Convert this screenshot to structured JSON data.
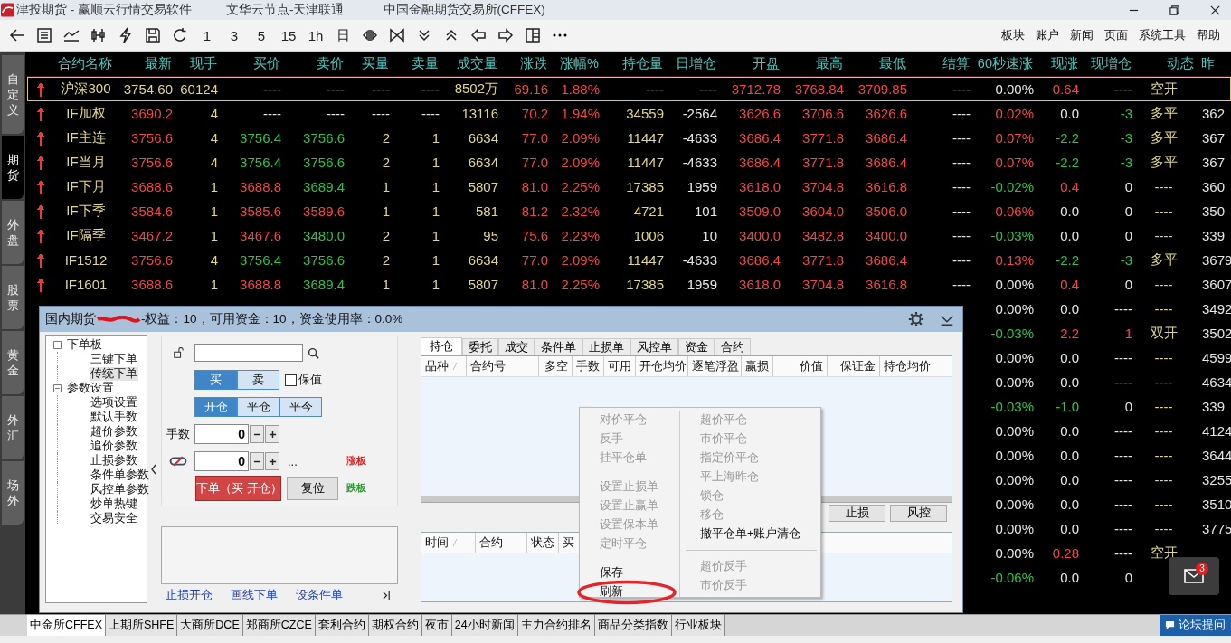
{
  "title_bar": {
    "title": "津投期货 - 赢顺云行情交易软件",
    "server": "文华云节点-天津联通",
    "exchange": "中国金融期货交易所(CFFEX)"
  },
  "toolbar": {
    "periods": [
      "1",
      "3",
      "5",
      "15",
      "1h",
      "日"
    ],
    "menu": [
      "板块",
      "账户",
      "新闻",
      "页面",
      "系统工具",
      "帮助"
    ]
  },
  "side_tabs": [
    {
      "label": "自定义",
      "selected": false
    },
    {
      "label": "期货",
      "selected": true
    },
    {
      "label": "外盘",
      "selected": false
    },
    {
      "label": "股票",
      "selected": false
    },
    {
      "label": "黄金",
      "selected": false
    },
    {
      "label": "外汇",
      "selected": false
    },
    {
      "label": "场外",
      "selected": false
    }
  ],
  "quotes": {
    "name_column": "合约名称",
    "columns": [
      "最新",
      "现手",
      "买价",
      "卖价",
      "买量",
      "卖量",
      "成交量",
      "涨跌",
      "涨幅%",
      "持仓量",
      "日增仓",
      "开盘",
      "最高",
      "最低",
      "结算",
      "60秒速涨",
      "现涨",
      "现增仓",
      "动态",
      "昨"
    ],
    "rows": [
      {
        "selected": true,
        "arrow": {
          "color": "#e83c3c"
        },
        "name": "沪深300",
        "cells": [
          {
            "text": "3754.60",
            "color": "#e2d68c"
          },
          {
            "text": "60124",
            "color": "#e2d68c"
          },
          {
            "text": "----",
            "color": "#e6e6e6"
          },
          {
            "text": "----",
            "color": "#e6e6e6"
          },
          {
            "text": "----",
            "color": "#e6e6e6"
          },
          {
            "text": "----",
            "color": "#e6e6e6"
          },
          {
            "text": "8502万",
            "color": "#e2d68c"
          },
          {
            "text": "69.16",
            "color": "#f04848"
          },
          {
            "text": "1.88%",
            "color": "#f04848"
          },
          {
            "text": "----",
            "color": "#e6e6e6"
          },
          {
            "text": "----",
            "color": "#e6e6e6"
          },
          {
            "text": "3712.78",
            "color": "#f04848"
          },
          {
            "text": "3768.84",
            "color": "#f04848"
          },
          {
            "text": "3709.85",
            "color": "#f04848"
          },
          {
            "text": "----",
            "color": "#e6e6e6"
          },
          {
            "text": "0.00%",
            "color": "#e6e6e6"
          },
          {
            "text": "0.64",
            "color": "#f04848"
          },
          {
            "text": "----",
            "color": "#e6e6e6"
          },
          {
            "text": "空开",
            "color": "#e2d68c"
          },
          {
            "text": ""
          }
        ]
      },
      {
        "selected": false,
        "arrow": {
          "color": "#e83c3c"
        },
        "name": "IF加权",
        "cells": [
          {
            "text": "3690.2",
            "color": "#f04848"
          },
          {
            "text": "4",
            "color": "#e2d68c"
          },
          {
            "text": "----",
            "color": "#e6e6e6"
          },
          {
            "text": "----",
            "color": "#e6e6e6"
          },
          {
            "text": "----",
            "color": "#e6e6e6"
          },
          {
            "text": "----",
            "color": "#e6e6e6"
          },
          {
            "text": "13116",
            "color": "#e2d68c"
          },
          {
            "text": "70.2",
            "color": "#f04848"
          },
          {
            "text": "1.94%",
            "color": "#f04848"
          },
          {
            "text": "34559",
            "color": "#e2d68c"
          },
          {
            "text": "-2564",
            "color": "#e6e6e6"
          },
          {
            "text": "3626.6",
            "color": "#f04848"
          },
          {
            "text": "3706.6",
            "color": "#f04848"
          },
          {
            "text": "3626.6",
            "color": "#f04848"
          },
          {
            "text": "----",
            "color": "#e6e6e6"
          },
          {
            "text": "0.02%",
            "color": "#f04848"
          },
          {
            "text": "0.0",
            "color": "#e6e6e6"
          },
          {
            "text": "-3",
            "color": "#2fc24a"
          },
          {
            "text": "多平",
            "color": "#e2d68c"
          },
          {
            "text": "362",
            "color": "#e6e6e6"
          }
        ]
      },
      {
        "selected": false,
        "arrow": {
          "color": "#e83c3c"
        },
        "name": "IF主连",
        "cells": [
          {
            "text": "3756.6",
            "color": "#f04848"
          },
          {
            "text": "4",
            "color": "#e2d68c"
          },
          {
            "text": "3756.4",
            "color": "#2fc24a"
          },
          {
            "text": "3756.6",
            "color": "#2fc24a"
          },
          {
            "text": "2",
            "color": "#e2d68c"
          },
          {
            "text": "1",
            "color": "#e2d68c"
          },
          {
            "text": "6634",
            "color": "#e2d68c"
          },
          {
            "text": "77.0",
            "color": "#f04848"
          },
          {
            "text": "2.09%",
            "color": "#f04848"
          },
          {
            "text": "11447",
            "color": "#e2d68c"
          },
          {
            "text": "-4633",
            "color": "#e6e6e6"
          },
          {
            "text": "3686.4",
            "color": "#f04848"
          },
          {
            "text": "3771.8",
            "color": "#f04848"
          },
          {
            "text": "3686.4",
            "color": "#f04848"
          },
          {
            "text": "----",
            "color": "#e6e6e6"
          },
          {
            "text": "0.07%",
            "color": "#f04848"
          },
          {
            "text": "-2.2",
            "color": "#2fc24a"
          },
          {
            "text": "-3",
            "color": "#2fc24a"
          },
          {
            "text": "多平",
            "color": "#e2d68c"
          },
          {
            "text": "367",
            "color": "#e6e6e6"
          }
        ]
      },
      {
        "selected": false,
        "arrow": {
          "color": "#e83c3c"
        },
        "name": "IF当月",
        "cells": [
          {
            "text": "3756.6",
            "color": "#f04848"
          },
          {
            "text": "4",
            "color": "#e2d68c"
          },
          {
            "text": "3756.4",
            "color": "#2fc24a"
          },
          {
            "text": "3756.6",
            "color": "#2fc24a"
          },
          {
            "text": "2",
            "color": "#e2d68c"
          },
          {
            "text": "1",
            "color": "#e2d68c"
          },
          {
            "text": "6634",
            "color": "#e2d68c"
          },
          {
            "text": "77.0",
            "color": "#f04848"
          },
          {
            "text": "2.09%",
            "color": "#f04848"
          },
          {
            "text": "11447",
            "color": "#e2d68c"
          },
          {
            "text": "-4633",
            "color": "#e6e6e6"
          },
          {
            "text": "3686.4",
            "color": "#f04848"
          },
          {
            "text": "3771.8",
            "color": "#f04848"
          },
          {
            "text": "3686.4",
            "color": "#f04848"
          },
          {
            "text": "----",
            "color": "#e6e6e6"
          },
          {
            "text": "0.07%",
            "color": "#f04848"
          },
          {
            "text": "-2.2",
            "color": "#2fc24a"
          },
          {
            "text": "-3",
            "color": "#2fc24a"
          },
          {
            "text": "多平",
            "color": "#e2d68c"
          },
          {
            "text": "367",
            "color": "#e6e6e6"
          }
        ]
      },
      {
        "selected": false,
        "arrow": {
          "color": "#e83c3c"
        },
        "name": "IF下月",
        "cells": [
          {
            "text": "3688.6",
            "color": "#f04848"
          },
          {
            "text": "1",
            "color": "#e2d68c"
          },
          {
            "text": "3688.8",
            "color": "#f04848"
          },
          {
            "text": "3689.4",
            "color": "#2fc24a"
          },
          {
            "text": "1",
            "color": "#e2d68c"
          },
          {
            "text": "1",
            "color": "#e2d68c"
          },
          {
            "text": "5807",
            "color": "#e2d68c"
          },
          {
            "text": "81.0",
            "color": "#f04848"
          },
          {
            "text": "2.25%",
            "color": "#f04848"
          },
          {
            "text": "17385",
            "color": "#e2d68c"
          },
          {
            "text": "1959",
            "color": "#e6e6e6"
          },
          {
            "text": "3618.0",
            "color": "#f04848"
          },
          {
            "text": "3704.8",
            "color": "#f04848"
          },
          {
            "text": "3616.8",
            "color": "#f04848"
          },
          {
            "text": "----",
            "color": "#e6e6e6"
          },
          {
            "text": "-0.02%",
            "color": "#2fc24a"
          },
          {
            "text": "0.4",
            "color": "#f04848"
          },
          {
            "text": "0",
            "color": "#e6e6e6"
          },
          {
            "text": "----",
            "color": "#e2d68c"
          },
          {
            "text": "360",
            "color": "#e6e6e6"
          }
        ]
      },
      {
        "selected": false,
        "arrow": {
          "color": "#e83c3c"
        },
        "name": "IF下季",
        "cells": [
          {
            "text": "3584.6",
            "color": "#f04848"
          },
          {
            "text": "1",
            "color": "#e2d68c"
          },
          {
            "text": "3585.6",
            "color": "#f04848"
          },
          {
            "text": "3589.6",
            "color": "#f04848"
          },
          {
            "text": "1",
            "color": "#e2d68c"
          },
          {
            "text": "1",
            "color": "#e2d68c"
          },
          {
            "text": "581",
            "color": "#e2d68c"
          },
          {
            "text": "81.2",
            "color": "#f04848"
          },
          {
            "text": "2.32%",
            "color": "#f04848"
          },
          {
            "text": "4721",
            "color": "#e2d68c"
          },
          {
            "text": "101",
            "color": "#e6e6e6"
          },
          {
            "text": "3509.0",
            "color": "#f04848"
          },
          {
            "text": "3604.0",
            "color": "#f04848"
          },
          {
            "text": "3506.0",
            "color": "#f04848"
          },
          {
            "text": "----",
            "color": "#e6e6e6"
          },
          {
            "text": "0.06%",
            "color": "#f04848"
          },
          {
            "text": "0.0",
            "color": "#e6e6e6"
          },
          {
            "text": "0",
            "color": "#e6e6e6"
          },
          {
            "text": "----",
            "color": "#e2d68c"
          },
          {
            "text": "350",
            "color": "#e6e6e6"
          }
        ]
      },
      {
        "selected": false,
        "arrow": {
          "color": "#e83c3c"
        },
        "name": "IF隔季",
        "cells": [
          {
            "text": "3467.2",
            "color": "#f04848"
          },
          {
            "text": "1",
            "color": "#e2d68c"
          },
          {
            "text": "3467.6",
            "color": "#f04848"
          },
          {
            "text": "3480.0",
            "color": "#2fc24a"
          },
          {
            "text": "2",
            "color": "#e2d68c"
          },
          {
            "text": "1",
            "color": "#e2d68c"
          },
          {
            "text": "95",
            "color": "#e2d68c"
          },
          {
            "text": "75.6",
            "color": "#f04848"
          },
          {
            "text": "2.23%",
            "color": "#f04848"
          },
          {
            "text": "1006",
            "color": "#e2d68c"
          },
          {
            "text": "10",
            "color": "#e6e6e6"
          },
          {
            "text": "3400.0",
            "color": "#f04848"
          },
          {
            "text": "3482.8",
            "color": "#f04848"
          },
          {
            "text": "3400.0",
            "color": "#f04848"
          },
          {
            "text": "----",
            "color": "#e6e6e6"
          },
          {
            "text": "-0.03%",
            "color": "#2fc24a"
          },
          {
            "text": "0.0",
            "color": "#e6e6e6"
          },
          {
            "text": "0",
            "color": "#e6e6e6"
          },
          {
            "text": "----",
            "color": "#e2d68c"
          },
          {
            "text": "339",
            "color": "#e6e6e6"
          }
        ]
      },
      {
        "selected": false,
        "arrow": {
          "color": "#e83c3c"
        },
        "name": "IF1512",
        "cells": [
          {
            "text": "3756.6",
            "color": "#f04848"
          },
          {
            "text": "4",
            "color": "#e2d68c"
          },
          {
            "text": "3756.4",
            "color": "#2fc24a"
          },
          {
            "text": "3756.6",
            "color": "#2fc24a"
          },
          {
            "text": "2",
            "color": "#e2d68c"
          },
          {
            "text": "1",
            "color": "#e2d68c"
          },
          {
            "text": "6634",
            "color": "#e2d68c"
          },
          {
            "text": "77.0",
            "color": "#f04848"
          },
          {
            "text": "2.09%",
            "color": "#f04848"
          },
          {
            "text": "11447",
            "color": "#e2d68c"
          },
          {
            "text": "-4633",
            "color": "#e6e6e6"
          },
          {
            "text": "3686.4",
            "color": "#f04848"
          },
          {
            "text": "3771.8",
            "color": "#f04848"
          },
          {
            "text": "3686.4",
            "color": "#f04848"
          },
          {
            "text": "----",
            "color": "#e6e6e6"
          },
          {
            "text": "0.13%",
            "color": "#f04848"
          },
          {
            "text": "-2.2",
            "color": "#2fc24a"
          },
          {
            "text": "-3",
            "color": "#2fc24a"
          },
          {
            "text": "多平",
            "color": "#e2d68c"
          },
          {
            "text": "3679",
            "color": "#e6e6e6"
          }
        ]
      },
      {
        "selected": false,
        "arrow": {
          "color": "#e83c3c"
        },
        "name": "IF1601",
        "cells": [
          {
            "text": "3688.6",
            "color": "#f04848"
          },
          {
            "text": "1",
            "color": "#e2d68c"
          },
          {
            "text": "3688.8",
            "color": "#f04848"
          },
          {
            "text": "3689.4",
            "color": "#2fc24a"
          },
          {
            "text": "1",
            "color": "#e2d68c"
          },
          {
            "text": "1",
            "color": "#e2d68c"
          },
          {
            "text": "5807",
            "color": "#e2d68c"
          },
          {
            "text": "81.0",
            "color": "#f04848"
          },
          {
            "text": "2.25%",
            "color": "#f04848"
          },
          {
            "text": "17385",
            "color": "#e2d68c"
          },
          {
            "text": "1959",
            "color": "#e6e6e6"
          },
          {
            "text": "3618.0",
            "color": "#f04848"
          },
          {
            "text": "3704.8",
            "color": "#f04848"
          },
          {
            "text": "3616.8",
            "color": "#f04848"
          },
          {
            "text": "----",
            "color": "#e6e6e6"
          },
          {
            "text": "0.00%",
            "color": "#e6e6e6"
          },
          {
            "text": "0.4",
            "color": "#f04848"
          },
          {
            "text": "0",
            "color": "#e6e6e6"
          },
          {
            "text": "----",
            "color": "#e2d68c"
          },
          {
            "text": "3607",
            "color": "#e6e6e6"
          }
        ]
      },
      {
        "selected": false,
        "cells": [
          {
            "text": ""
          },
          {
            "text": ""
          },
          {
            "text": ""
          },
          {
            "text": ""
          },
          {
            "text": ""
          },
          {
            "text": ""
          },
          {
            "text": ""
          },
          {
            "text": ""
          },
          {
            "text": ""
          },
          {
            "text": ""
          },
          {
            "text": ""
          },
          {
            "text": ""
          },
          {
            "text": ""
          },
          {
            "text": ""
          },
          {
            "text": ""
          },
          {
            "text": "0.00%",
            "color": "#e6e6e6"
          },
          {
            "text": "0.0",
            "color": "#e6e6e6"
          },
          {
            "text": "----",
            "color": "#e6e6e6"
          },
          {
            "text": "----",
            "color": "#e2d68c"
          },
          {
            "text": "3492",
            "color": "#e6e6e6"
          }
        ]
      },
      {
        "selected": false,
        "cells": [
          {
            "text": ""
          },
          {
            "text": ""
          },
          {
            "text": ""
          },
          {
            "text": ""
          },
          {
            "text": ""
          },
          {
            "text": ""
          },
          {
            "text": ""
          },
          {
            "text": ""
          },
          {
            "text": ""
          },
          {
            "text": ""
          },
          {
            "text": ""
          },
          {
            "text": ""
          },
          {
            "text": ""
          },
          {
            "text": ""
          },
          {
            "text": ""
          },
          {
            "text": "-0.03%",
            "color": "#2fc24a"
          },
          {
            "text": "2.2",
            "color": "#f04848"
          },
          {
            "text": "1",
            "color": "#f04848"
          },
          {
            "text": "双开",
            "color": "#e2d68c"
          },
          {
            "text": "3502",
            "color": "#e6e6e6"
          }
        ]
      },
      {
        "selected": false,
        "cells": [
          {
            "text": ""
          },
          {
            "text": ""
          },
          {
            "text": ""
          },
          {
            "text": ""
          },
          {
            "text": ""
          },
          {
            "text": ""
          },
          {
            "text": ""
          },
          {
            "text": ""
          },
          {
            "text": ""
          },
          {
            "text": ""
          },
          {
            "text": ""
          },
          {
            "text": ""
          },
          {
            "text": ""
          },
          {
            "text": ""
          },
          {
            "text": ""
          },
          {
            "text": "0.00%",
            "color": "#e6e6e6"
          },
          {
            "text": "0.0",
            "color": "#e6e6e6"
          },
          {
            "text": "----",
            "color": "#e6e6e6"
          },
          {
            "text": "----",
            "color": "#e2d68c"
          },
          {
            "text": "4599",
            "color": "#e6e6e6"
          }
        ]
      },
      {
        "selected": false,
        "cells": [
          {
            "text": ""
          },
          {
            "text": ""
          },
          {
            "text": ""
          },
          {
            "text": ""
          },
          {
            "text": ""
          },
          {
            "text": ""
          },
          {
            "text": ""
          },
          {
            "text": ""
          },
          {
            "text": ""
          },
          {
            "text": ""
          },
          {
            "text": ""
          },
          {
            "text": ""
          },
          {
            "text": ""
          },
          {
            "text": ""
          },
          {
            "text": ""
          },
          {
            "text": "0.00%",
            "color": "#e6e6e6"
          },
          {
            "text": "0.0",
            "color": "#e6e6e6"
          },
          {
            "text": "----",
            "color": "#e6e6e6"
          },
          {
            "text": "----",
            "color": "#e2d68c"
          },
          {
            "text": "4634",
            "color": "#e6e6e6"
          }
        ]
      },
      {
        "selected": false,
        "cells": [
          {
            "text": ""
          },
          {
            "text": ""
          },
          {
            "text": ""
          },
          {
            "text": ""
          },
          {
            "text": ""
          },
          {
            "text": ""
          },
          {
            "text": ""
          },
          {
            "text": ""
          },
          {
            "text": ""
          },
          {
            "text": ""
          },
          {
            "text": ""
          },
          {
            "text": ""
          },
          {
            "text": ""
          },
          {
            "text": ""
          },
          {
            "text": ""
          },
          {
            "text": "-0.03%",
            "color": "#2fc24a"
          },
          {
            "text": "-1.0",
            "color": "#2fc24a"
          },
          {
            "text": "0",
            "color": "#e6e6e6"
          },
          {
            "text": "----",
            "color": "#e2d68c"
          },
          {
            "text": "339",
            "color": "#e6e6e6"
          }
        ]
      },
      {
        "selected": false,
        "cells": [
          {
            "text": ""
          },
          {
            "text": ""
          },
          {
            "text": ""
          },
          {
            "text": ""
          },
          {
            "text": ""
          },
          {
            "text": ""
          },
          {
            "text": ""
          },
          {
            "text": ""
          },
          {
            "text": ""
          },
          {
            "text": ""
          },
          {
            "text": ""
          },
          {
            "text": ""
          },
          {
            "text": ""
          },
          {
            "text": ""
          },
          {
            "text": ""
          },
          {
            "text": "0.00%",
            "color": "#e6e6e6"
          },
          {
            "text": "0.0",
            "color": "#e6e6e6"
          },
          {
            "text": "----",
            "color": "#e6e6e6"
          },
          {
            "text": "----",
            "color": "#e2d68c"
          },
          {
            "text": "4124",
            "color": "#e6e6e6"
          }
        ]
      },
      {
        "selected": false,
        "cells": [
          {
            "text": ""
          },
          {
            "text": ""
          },
          {
            "text": ""
          },
          {
            "text": ""
          },
          {
            "text": ""
          },
          {
            "text": ""
          },
          {
            "text": ""
          },
          {
            "text": ""
          },
          {
            "text": ""
          },
          {
            "text": ""
          },
          {
            "text": ""
          },
          {
            "text": ""
          },
          {
            "text": ""
          },
          {
            "text": ""
          },
          {
            "text": ""
          },
          {
            "text": "0.00%",
            "color": "#e6e6e6"
          },
          {
            "text": "0.0",
            "color": "#e6e6e6"
          },
          {
            "text": "----",
            "color": "#e6e6e6"
          },
          {
            "text": "----",
            "color": "#e2d68c"
          },
          {
            "text": "3644",
            "color": "#e6e6e6"
          }
        ]
      },
      {
        "selected": false,
        "cells": [
          {
            "text": ""
          },
          {
            "text": ""
          },
          {
            "text": ""
          },
          {
            "text": ""
          },
          {
            "text": ""
          },
          {
            "text": ""
          },
          {
            "text": ""
          },
          {
            "text": ""
          },
          {
            "text": ""
          },
          {
            "text": ""
          },
          {
            "text": ""
          },
          {
            "text": ""
          },
          {
            "text": ""
          },
          {
            "text": ""
          },
          {
            "text": ""
          },
          {
            "text": "0.00%",
            "color": "#e6e6e6"
          },
          {
            "text": "0.0",
            "color": "#e6e6e6"
          },
          {
            "text": "----",
            "color": "#e6e6e6"
          },
          {
            "text": "----",
            "color": "#e2d68c"
          },
          {
            "text": "3255",
            "color": "#e6e6e6"
          }
        ]
      },
      {
        "selected": false,
        "cells": [
          {
            "text": ""
          },
          {
            "text": ""
          },
          {
            "text": ""
          },
          {
            "text": ""
          },
          {
            "text": ""
          },
          {
            "text": ""
          },
          {
            "text": ""
          },
          {
            "text": ""
          },
          {
            "text": ""
          },
          {
            "text": ""
          },
          {
            "text": ""
          },
          {
            "text": ""
          },
          {
            "text": ""
          },
          {
            "text": ""
          },
          {
            "text": ""
          },
          {
            "text": "0.00%",
            "color": "#e6e6e6"
          },
          {
            "text": "0.0",
            "color": "#e6e6e6"
          },
          {
            "text": "----",
            "color": "#e6e6e6"
          },
          {
            "text": "----",
            "color": "#e2d68c"
          },
          {
            "text": "3510",
            "color": "#e6e6e6"
          }
        ]
      },
      {
        "selected": false,
        "cells": [
          {
            "text": ""
          },
          {
            "text": ""
          },
          {
            "text": ""
          },
          {
            "text": ""
          },
          {
            "text": ""
          },
          {
            "text": ""
          },
          {
            "text": ""
          },
          {
            "text": ""
          },
          {
            "text": ""
          },
          {
            "text": ""
          },
          {
            "text": ""
          },
          {
            "text": ""
          },
          {
            "text": ""
          },
          {
            "text": ""
          },
          {
            "text": ""
          },
          {
            "text": "0.00%",
            "color": "#e6e6e6"
          },
          {
            "text": "0.0",
            "color": "#e6e6e6"
          },
          {
            "text": "----",
            "color": "#e6e6e6"
          },
          {
            "text": "----",
            "color": "#e2d68c"
          },
          {
            "text": "3775",
            "color": "#e6e6e6"
          }
        ]
      },
      {
        "selected": false,
        "cells": [
          {
            "text": ""
          },
          {
            "text": ""
          },
          {
            "text": ""
          },
          {
            "text": ""
          },
          {
            "text": ""
          },
          {
            "text": ""
          },
          {
            "text": ""
          },
          {
            "text": ""
          },
          {
            "text": ""
          },
          {
            "text": ""
          },
          {
            "text": ""
          },
          {
            "text": ""
          },
          {
            "text": ""
          },
          {
            "text": ""
          },
          {
            "text": ""
          },
          {
            "text": "0.00%",
            "color": "#e6e6e6"
          },
          {
            "text": "0.28",
            "color": "#f04848"
          },
          {
            "text": "----",
            "color": "#e6e6e6"
          },
          {
            "text": "空开",
            "color": "#e2d68c"
          },
          {
            "text": ""
          }
        ]
      },
      {
        "selected": false,
        "cells": [
          {
            "text": ""
          },
          {
            "text": ""
          },
          {
            "text": ""
          },
          {
            "text": ""
          },
          {
            "text": ""
          },
          {
            "text": ""
          },
          {
            "text": ""
          },
          {
            "text": ""
          },
          {
            "text": ""
          },
          {
            "text": ""
          },
          {
            "text": ""
          },
          {
            "text": ""
          },
          {
            "text": ""
          },
          {
            "text": ""
          },
          {
            "text": ""
          },
          {
            "text": "-0.06%",
            "color": "#2fc24a"
          },
          {
            "text": "0.0",
            "color": "#e6e6e6"
          },
          {
            "text": "0",
            "color": "#e6e6e6"
          },
          {
            "text": ""
          },
          {
            "text": ""
          }
        ]
      }
    ]
  },
  "panel": {
    "title": "国内期货",
    "summary": "-权益：10，可用资金：10，资金使用率：0.0%",
    "tree": [
      {
        "label": "下单板",
        "expanded": true,
        "children": [
          {
            "label": "三键下单",
            "selected": false
          },
          {
            "label": "传统下单",
            "selected": true
          }
        ]
      },
      {
        "label": "参数设置",
        "expanded": true,
        "children": [
          {
            "label": "选项设置",
            "selected": false
          },
          {
            "label": "默认手数",
            "selected": false
          },
          {
            "label": "超价参数",
            "selected": false
          },
          {
            "label": "追价参数",
            "selected": false
          },
          {
            "label": "止损参数",
            "selected": false
          },
          {
            "label": "条件单参数",
            "selected": false
          },
          {
            "label": "风控单参数",
            "selected": false
          },
          {
            "label": "炒单热键",
            "selected": false
          },
          {
            "label": "交易安全",
            "selected": false
          }
        ]
      }
    ],
    "order": {
      "direction": [
        {
          "label": "买",
          "selected": true
        },
        {
          "label": "卖",
          "selected": false
        }
      ],
      "hedge": {
        "label": "保值",
        "checked": false
      },
      "offset": [
        {
          "label": "开仓",
          "selected": true
        },
        {
          "label": "平仓",
          "selected": false
        },
        {
          "label": "平今",
          "selected": false
        }
      ],
      "qty_label": "手数",
      "qty": "0",
      "price": "0",
      "price_more": "...",
      "limit_up": "涨板",
      "limit_down": "跌板",
      "submit": "下单（买 开仓）",
      "reset": "复位"
    },
    "links": [
      "止损开仓",
      "画线下单",
      "设条件单"
    ],
    "tabs": [
      {
        "label": "持仓",
        "selected": true
      },
      {
        "label": "委托",
        "selected": false
      },
      {
        "label": "成交",
        "selected": false
      },
      {
        "label": "条件单",
        "selected": false
      },
      {
        "label": "止损单",
        "selected": false
      },
      {
        "label": "风控单",
        "selected": false
      },
      {
        "label": "资金",
        "selected": false
      },
      {
        "label": "合约",
        "selected": false
      }
    ],
    "position_columns": [
      "品种",
      "合约号",
      "多空",
      "手数",
      "可用",
      "开仓均价",
      "逐笔浮盈",
      "赢损",
      "价值",
      "保证金",
      "持仓均价"
    ],
    "action_buttons": [
      "止损",
      "风控"
    ],
    "order_columns": [
      "时间",
      "合约",
      "状态",
      "买"
    ],
    "context_menu": [
      {
        "groups": [
          [
            {
              "label": "对价平仓",
              "disabled": true,
              "circled": false
            },
            {
              "label": "反手",
              "disabled": true,
              "circled": false
            },
            {
              "label": "挂平仓单",
              "disabled": true,
              "circled": false
            }
          ],
          [
            {
              "label": "设置止损单",
              "disabled": true,
              "circled": false
            },
            {
              "label": "设置止赢单",
              "disabled": true,
              "circled": false
            },
            {
              "label": "设置保本单",
              "disabled": true,
              "circled": false
            },
            {
              "label": "定时平仓",
              "disabled": true,
              "circled": false
            }
          ],
          [
            {
              "label": "保存",
              "disabled": false,
              "circled": false
            },
            {
              "label": "刷新",
              "disabled": false,
              "circled": true
            }
          ]
        ]
      },
      {
        "groups": [
          [
            {
              "label": "超价平仓",
              "disabled": true,
              "circled": false
            },
            {
              "label": "市价平仓",
              "disabled": true,
              "circled": false
            },
            {
              "label": "指定价平仓",
              "disabled": true,
              "circled": false
            },
            {
              "label": "平上海昨仓",
              "disabled": true,
              "circled": false
            },
            {
              "label": "锁仓",
              "disabled": true,
              "circled": false
            },
            {
              "label": "移仓",
              "disabled": true,
              "circled": false
            },
            {
              "label": "撤平仓单+账户清仓",
              "disabled": false,
              "circled": false
            }
          ],
          [
            {
              "label": "超价反手",
              "disabled": true,
              "circled": false
            },
            {
              "label": "市价反手",
              "disabled": true,
              "circled": false
            }
          ]
        ]
      }
    ]
  },
  "mail": {
    "count": "3"
  },
  "exchange_tabs": [
    {
      "label": "中金所CFFEX",
      "selected": true
    },
    {
      "label": "上期所SHFE",
      "selected": false
    },
    {
      "label": "大商所DCE",
      "selected": false
    },
    {
      "label": "郑商所CZCE",
      "selected": false
    },
    {
      "label": "套利合约",
      "selected": false
    },
    {
      "label": "期权合约",
      "selected": false
    },
    {
      "label": "夜市",
      "selected": false
    },
    {
      "label": "24小时新闻",
      "selected": false
    },
    {
      "label": "主力合约排名",
      "selected": false
    },
    {
      "label": "商品分类指数",
      "selected": false
    },
    {
      "label": "行业板块",
      "selected": false
    }
  ],
  "forum": "论坛提问"
}
